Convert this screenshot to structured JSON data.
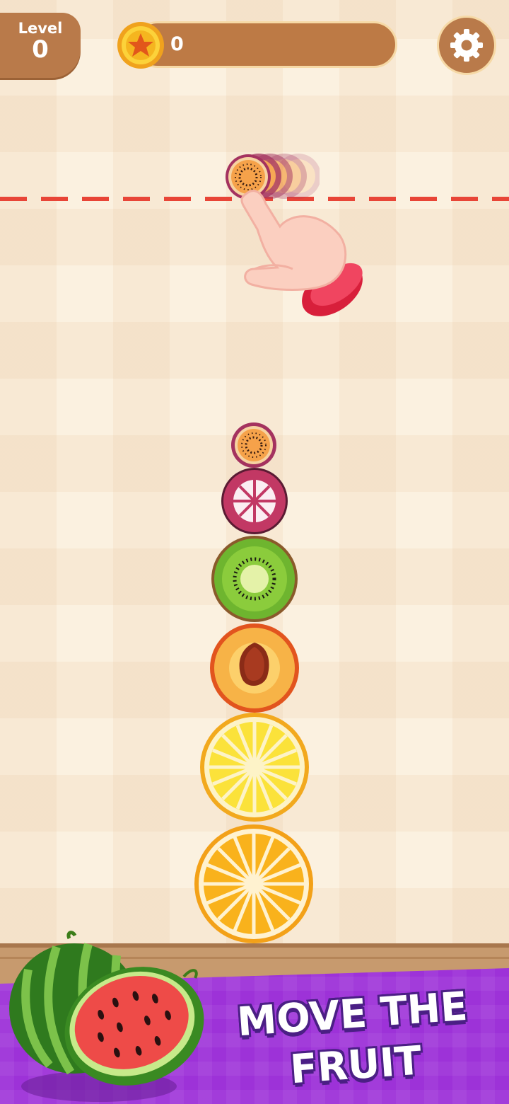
{
  "hud": {
    "level_label": "Level",
    "level_value": "0",
    "coins": "0",
    "coin_icon": "star-coin-icon",
    "settings_icon": "gear-icon"
  },
  "drop_line": {
    "color": "#e84537"
  },
  "tutorial": {
    "hand_icon": "pointing-hand-icon",
    "held_fruit": "passion-fruit"
  },
  "stack": [
    "passion-fruit",
    "mangosteen",
    "kiwi",
    "peach",
    "lemon",
    "orange"
  ],
  "banner": {
    "line1": "MOVE THE",
    "line2": "FRUIT",
    "color": "#9d32d8",
    "image": "watermelon-icon"
  }
}
